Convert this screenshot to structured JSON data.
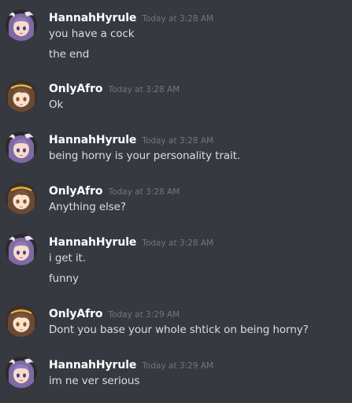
{
  "messages": [
    {
      "author": "HannahHyrule",
      "avatar": "purple-hair-anime-girl-avatar",
      "timestamp": "Today at 3:28 AM",
      "lines": [
        "you have a cock",
        "the end"
      ]
    },
    {
      "author": "OnlyAfro",
      "avatar": "brown-hair-anime-girl-avatar",
      "timestamp": "Today at 3:28 AM",
      "lines": [
        "Ok"
      ]
    },
    {
      "author": "HannahHyrule",
      "avatar": "purple-hair-anime-girl-avatar",
      "timestamp": "Today at 3:28 AM",
      "lines": [
        "being horny is your personality trait."
      ]
    },
    {
      "author": "OnlyAfro",
      "avatar": "brown-hair-anime-girl-avatar",
      "timestamp": "Today at 3:28 AM",
      "lines": [
        "Anything else?"
      ]
    },
    {
      "author": "HannahHyrule",
      "avatar": "purple-hair-anime-girl-avatar",
      "timestamp": "Today at 3:28 AM",
      "lines": [
        "i get it.",
        "funny"
      ]
    },
    {
      "author": "OnlyAfro",
      "avatar": "brown-hair-anime-girl-avatar",
      "timestamp": "Today at 3:29 AM",
      "lines": [
        "Dont you base your whole shtick on being horny?"
      ]
    },
    {
      "author": "HannahHyrule",
      "avatar": "purple-hair-anime-girl-avatar",
      "timestamp": "Today at 3:29 AM",
      "lines": [
        "im ne ver serious"
      ]
    }
  ],
  "colors": {
    "background": "#36393f",
    "username": "#ffffff",
    "timestamp": "#72767d",
    "message_text": "#dcddde"
  }
}
